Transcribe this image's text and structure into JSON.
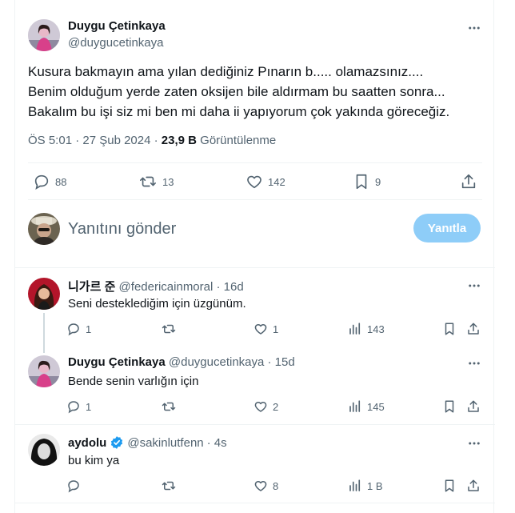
{
  "main_tweet": {
    "author_name": "Duygu Çetinkaya",
    "author_handle": "@duygucetinkaya",
    "lines": [
      "Kusura bakmayın ama yılan dediğiniz Pınarın b..... olamazsınız....",
      "Benim olduğum yerde zaten oksijen bile aldırmam bu saatten sonra...",
      "Bakalım bu işi siz mi ben mi daha ii yapıyorum çok yakında göreceğiz."
    ],
    "time": "ÖS 5:01 · 27 Şub 2024 ·",
    "views_count": "23,9 B",
    "views_label": "Görüntülenme",
    "replies": "88",
    "retweets": "13",
    "likes": "142",
    "bookmarks": "9"
  },
  "compose": {
    "placeholder": "Yanıtını gönder",
    "button": "Yanıtla"
  },
  "replies": [
    {
      "name": "니가르 준",
      "handle": "@federicainmoral",
      "age": "· 16d",
      "text": "Seni desteklediğim için üzgünüm.",
      "replies": "1",
      "retweets": "",
      "likes": "1",
      "views": "143",
      "verified": false
    },
    {
      "name": "Duygu Çetinkaya",
      "handle": "@duygucetinkaya",
      "age": "· 15d",
      "text": "Bende senin varlığın için",
      "replies": "1",
      "retweets": "",
      "likes": "2",
      "views": "145",
      "verified": false
    },
    {
      "name": "aydolu",
      "handle": "@sakinlutfenn",
      "age": "· 4s",
      "text": "bu kim ya",
      "replies": "",
      "retweets": "",
      "likes": "8",
      "views": "1 B",
      "verified": true
    }
  ],
  "colors": {
    "accent": "#1d9bf0",
    "reply_button": "#8ecdf8",
    "muted": "#536471",
    "border": "#eff3f4"
  }
}
